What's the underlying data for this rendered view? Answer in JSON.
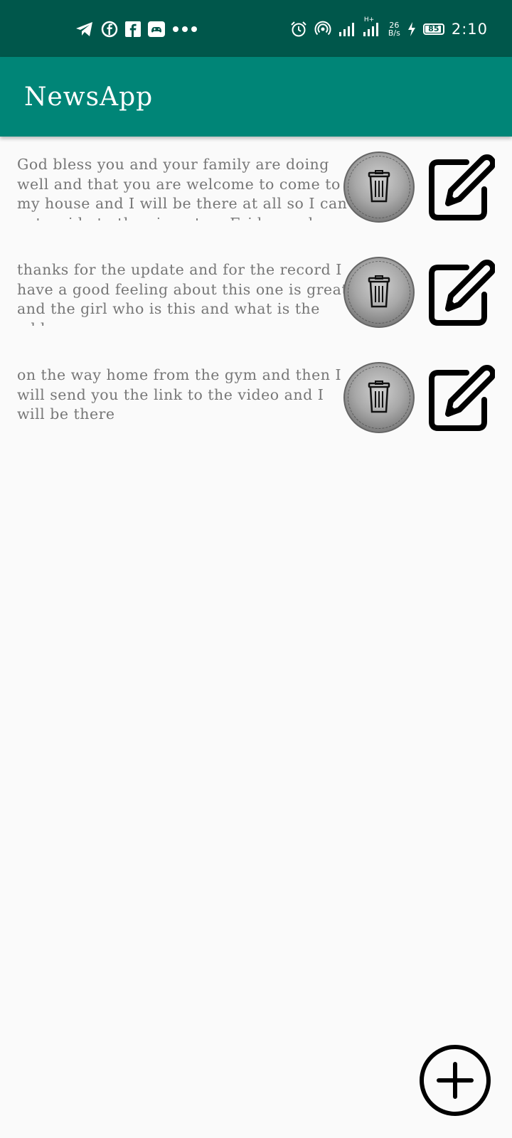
{
  "status_bar": {
    "time": "2:10",
    "network_speed_value": "26",
    "network_speed_unit": "B/s",
    "network_type": "H+",
    "battery_level": "85",
    "icons_left": [
      "telegram-icon",
      "facebook-icon",
      "facebook-square-icon",
      "game-controller-icon",
      "more-dots-icon"
    ],
    "icons_right": [
      "alarm-icon",
      "hotspot-icon",
      "signal-icon",
      "signal-icon",
      "charging-icon",
      "battery-icon"
    ]
  },
  "app_bar": {
    "title": "NewsApp",
    "color": "#008577",
    "status_color": "#00574b"
  },
  "notes": [
    {
      "text": "God bless you and your family are doing well and that you are welcome to come to my house and I will be there at all so I can get a ride to the airport on Friday and Saturday"
    },
    {
      "text": "thanks for the update and for the record I have a good feeling about this one is great and the girl who is this and what is the address"
    },
    {
      "text": "on the way home from the gym and then I will send you the link to the video and I will be there"
    }
  ],
  "actions": {
    "delete_icon": "trash-icon",
    "edit_icon": "edit-icon",
    "fab_icon": "add-icon"
  }
}
